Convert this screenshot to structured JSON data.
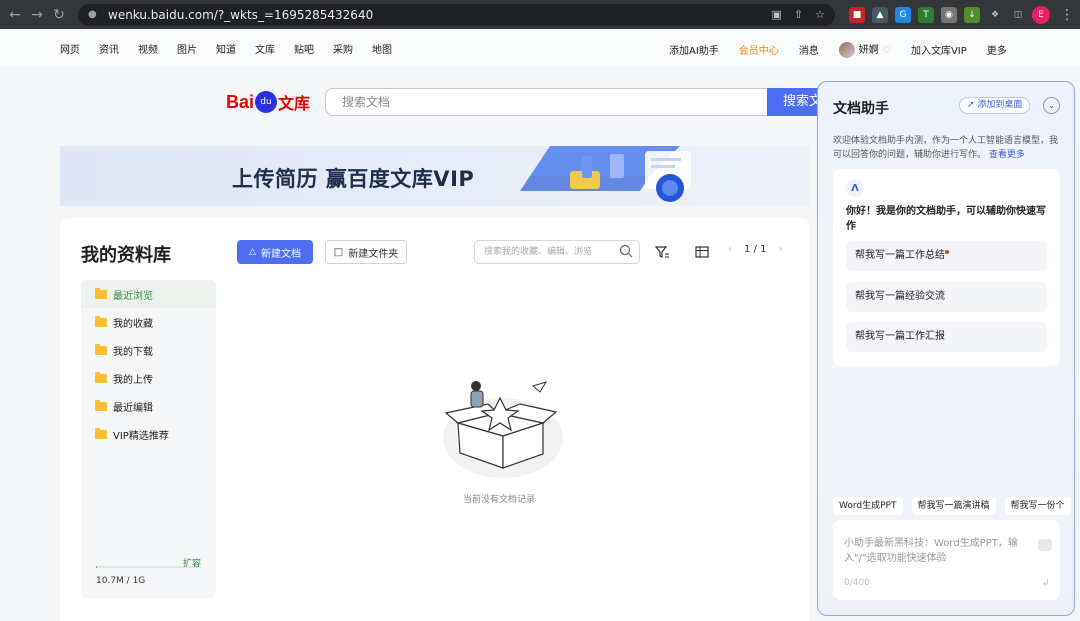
{
  "browser": {
    "url": "wenku.baidu.com/?_wkts_=1695285432640",
    "profile_initial": "E"
  },
  "topnav": {
    "left": [
      "网页",
      "资讯",
      "视频",
      "图片",
      "知道",
      "文库",
      "贴吧",
      "采购",
      "地图"
    ],
    "ai_helper": "添加AI助手",
    "vip_center": "会员中心",
    "messages": "消息",
    "username": "妍婀",
    "join_vip": "加入文库VIP",
    "more": "更多"
  },
  "logo": {
    "bai": "Bai",
    "du": "du",
    "wenku": "文库"
  },
  "search": {
    "placeholder": "搜索文档",
    "button": "搜索文"
  },
  "banner": {
    "text": "上传简历  赢百度文库VIP"
  },
  "library": {
    "title": "我的资料库",
    "new_doc": "新建文档",
    "new_folder": "新建文件夹",
    "search_placeholder": "搜索我的收藏、编辑、浏览",
    "pager": {
      "current": "1 / 1"
    },
    "sidebar": [
      {
        "label": "最近浏览",
        "active": true
      },
      {
        "label": "我的收藏"
      },
      {
        "label": "我的下载"
      },
      {
        "label": "我的上传"
      },
      {
        "label": "最近编辑"
      },
      {
        "label": "VIP精选推荐"
      }
    ],
    "storage": {
      "expand": "扩容",
      "used": "10.7M",
      "total": "1G",
      "usage_fraction": 0.01
    },
    "empty_text": "当前没有文档记录"
  },
  "assistant": {
    "title": "文档助手",
    "add_desktop": "添加到桌面",
    "intro": "欢迎体验文档助手内测，作为一个人工智能语言模型，我可以回答你的问题，辅助你进行写作。",
    "intro_more": "查看更多",
    "greeting": "你好！我是你的文档助手，可以辅助你快速写作",
    "options": [
      "帮我写一篇工作总结",
      "帮我写一篇经验交流",
      "帮我写一篇工作汇报"
    ],
    "chips": [
      "Word生成PPT",
      "帮我写一篇演讲稿",
      "帮我写一份个"
    ],
    "input_placeholder": "小助手最新黑科技：Word生成PPT，输入\"/\"选取功能快速体验",
    "input_count": "0/400"
  },
  "colors": {
    "accent": "#4e6ef2",
    "vip": "#f08a00",
    "brand_red": "#e10601",
    "active_green": "#2b8a3e"
  }
}
